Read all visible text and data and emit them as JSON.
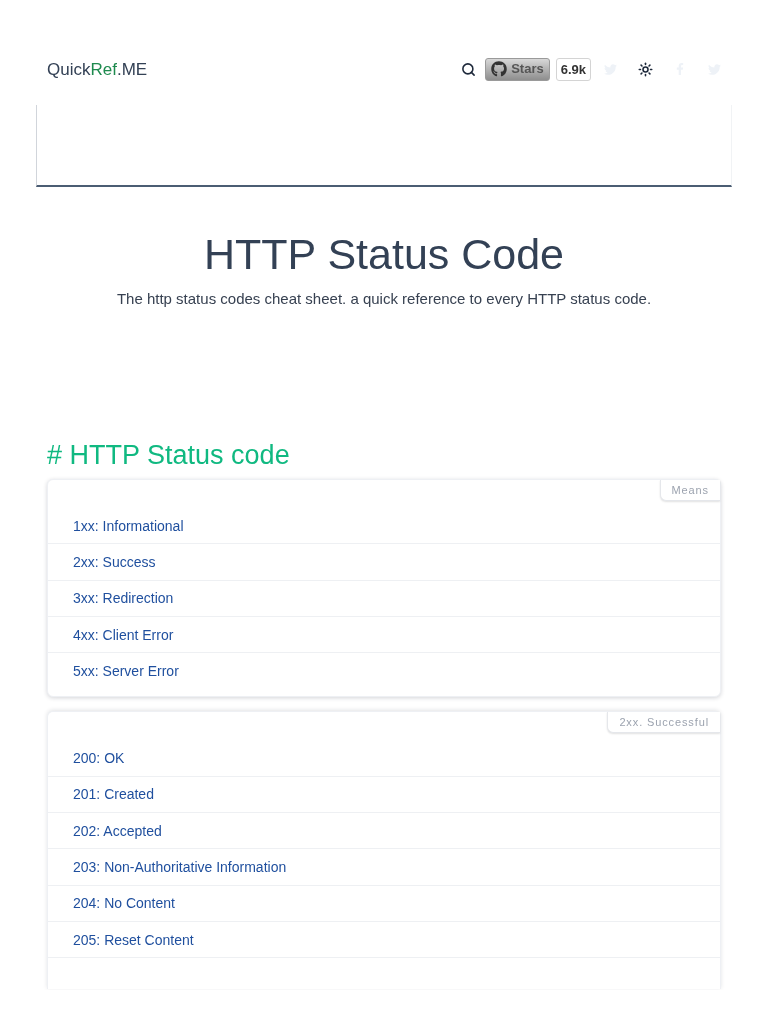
{
  "header": {
    "logo": {
      "prefix": "Quick",
      "highlight": "Ref",
      "suffix": ".ME"
    },
    "github": {
      "label": "Stars",
      "count": "6.9k"
    }
  },
  "hero": {
    "title": "HTTP Status Code",
    "subtitle": "The http status codes cheat sheet. a quick reference to every HTTP status code."
  },
  "section": {
    "marker": "#",
    "heading": "HTTP Status code",
    "cards": [
      {
        "tag": "Means",
        "items": [
          "1xx: Informational",
          "2xx: Success",
          "3xx: Redirection",
          "4xx: Client Error",
          "5xx: Server Error"
        ],
        "cut_off": false
      },
      {
        "tag": "2xx. Successful",
        "items": [
          "200: OK",
          "201: Created",
          "202: Accepted",
          "203: Non-Authoritative Information",
          "204: No Content",
          "205: Reset Content"
        ],
        "cut_off": true
      }
    ]
  }
}
